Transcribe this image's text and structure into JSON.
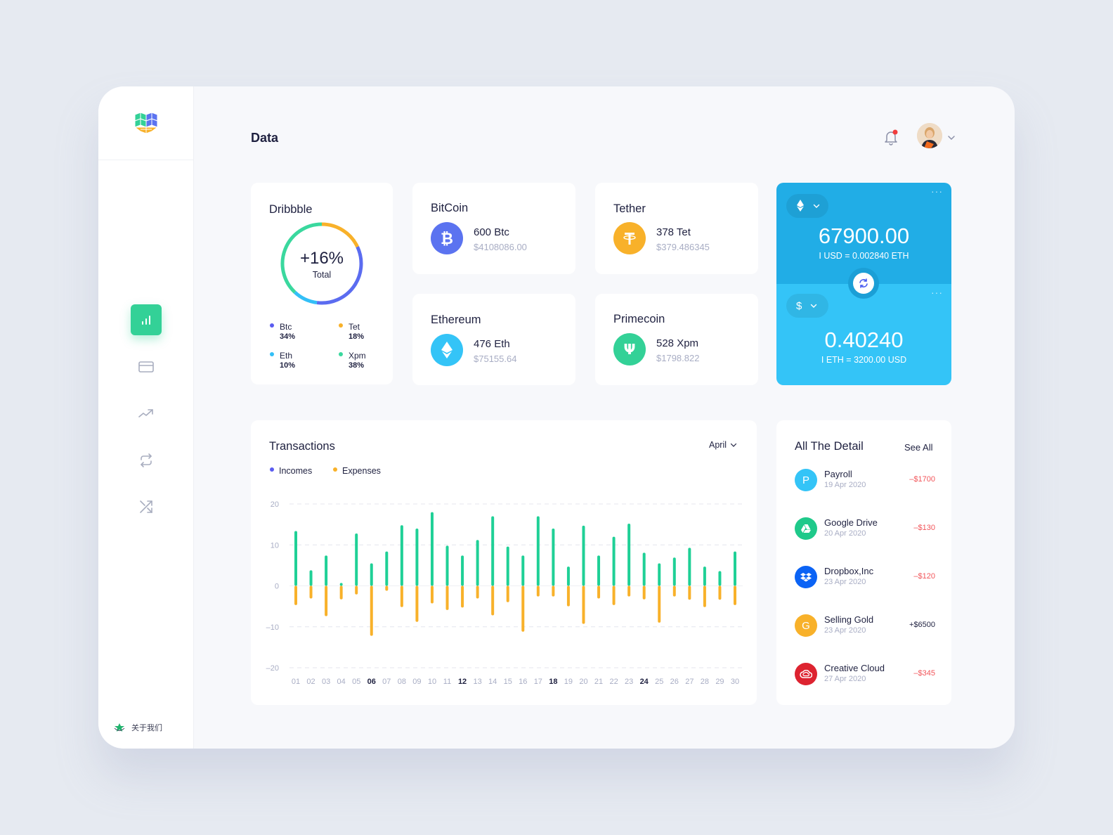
{
  "header": {
    "title": "Data",
    "notification_icon": "bell-icon",
    "has_unread_notification": true,
    "avatar": "user-avatar"
  },
  "sidebar": {
    "logo": "cube-logo",
    "items": [
      {
        "name": "dashboard",
        "icon": "bar-chart-icon",
        "active": true
      },
      {
        "name": "cards",
        "icon": "credit-card-icon",
        "active": false
      },
      {
        "name": "trends",
        "icon": "trending-up-icon",
        "active": false
      },
      {
        "name": "exchange",
        "icon": "repeat-icon",
        "active": false
      },
      {
        "name": "shuffle",
        "icon": "shuffle-icon",
        "active": false
      }
    ],
    "about_label": "关于我们"
  },
  "portfolio": {
    "title": "Dribbble",
    "total_value": "+16%",
    "total_label": "Total",
    "segments": [
      {
        "name": "Btc",
        "percent": 34,
        "percent_label": "34%",
        "color": "#5b6cf0"
      },
      {
        "name": "Tet",
        "percent": 18,
        "percent_label": "18%",
        "color": "#f8b12a"
      },
      {
        "name": "Eth",
        "percent": 10,
        "percent_label": "10%",
        "color": "#33bff7"
      },
      {
        "name": "Xpm",
        "percent": 38,
        "percent_label": "38%",
        "color": "#3ad89e"
      }
    ]
  },
  "coins": [
    {
      "title": "BitCoin",
      "amount": "600 Btc",
      "usd": "$4108086.00",
      "icon": "bitcoin-icon",
      "color": "#5b73f0"
    },
    {
      "title": "Tether",
      "amount": "378 Tet",
      "usd": "$379.486345",
      "icon": "tether-icon",
      "color": "#f8b12a"
    },
    {
      "title": "Ethereum",
      "amount": "476 Eth",
      "usd": "$75155.64",
      "icon": "ethereum-icon",
      "color": "#34c4f7"
    },
    {
      "title": "Primecoin",
      "amount": "528 Xpm",
      "usd": "$1798.822",
      "icon": "primecoin-icon",
      "color": "#33d197"
    }
  ],
  "exchange": {
    "from": {
      "currency_icon": "ethereum-icon",
      "value": "67900.00",
      "rate": "I USD = 0.002840 ETH"
    },
    "to": {
      "currency_symbol": "$",
      "value": "0.40240",
      "rate": "I ETH = 3200.00 USD"
    },
    "more_label": "···"
  },
  "transactions": {
    "title": "Transactions",
    "month": "April",
    "legend": [
      {
        "label": "Incomes",
        "color": "#5b5cf0"
      },
      {
        "label": "Expenses",
        "color": "#f8b12a"
      }
    ]
  },
  "chart_data": {
    "type": "bar",
    "title": "Transactions",
    "xlabel": "",
    "ylabel": "",
    "ylim": [
      -20,
      20
    ],
    "yticks": [
      "20",
      "10",
      "0",
      "–10",
      "–20"
    ],
    "ytick_values": [
      20,
      10,
      0,
      -10,
      -20
    ],
    "grid": true,
    "legend_position": "top-left",
    "categories": [
      "01",
      "02",
      "03",
      "04",
      "05",
      "06",
      "07",
      "08",
      "09",
      "10",
      "11",
      "12",
      "13",
      "14",
      "15",
      "16",
      "17",
      "18",
      "19",
      "20",
      "21",
      "22",
      "23",
      "24",
      "25",
      "26",
      "27",
      "28",
      "29",
      "30"
    ],
    "highlighted_categories": [
      "06",
      "12",
      "18",
      "24"
    ],
    "series": [
      {
        "name": "Incomes",
        "color": "#1fd096",
        "values": [
          13.4,
          3.8,
          7.4,
          0.7,
          12.8,
          5.5,
          8.4,
          14.8,
          14.0,
          18.0,
          9.8,
          7.4,
          11.2,
          17.0,
          9.6,
          7.4,
          17.0,
          14.0,
          4.7,
          14.7,
          7.4,
          12.0,
          15.2,
          8.1,
          5.5,
          6.9,
          9.3,
          4.7,
          3.6,
          8.4
        ]
      },
      {
        "name": "Expenses",
        "color": "#f8b12a",
        "values": [
          -4.7,
          -3.1,
          -7.4,
          -3.3,
          -2.1,
          -12.2,
          -1.2,
          -5.2,
          -8.8,
          -4.3,
          -5.9,
          -5.3,
          -3.1,
          -7.2,
          -4.0,
          -11.2,
          -2.6,
          -2.6,
          -5.0,
          -9.3,
          -3.1,
          -4.7,
          -2.6,
          -3.3,
          -9.0,
          -2.6,
          -3.4,
          -5.2,
          -3.4,
          -4.7
        ]
      }
    ]
  },
  "details": {
    "title": "All The Detail",
    "see_all_label": "See All",
    "items": [
      {
        "name": "Payroll",
        "date": "19 Apr 2020",
        "amount": "–$1700",
        "type": "expense",
        "icon": "letter-p-icon",
        "icon_text": "P",
        "color": "#34c4f7"
      },
      {
        "name": "Google Drive",
        "date": "20 Apr 2020",
        "amount": "–$130",
        "type": "expense",
        "icon": "google-drive-icon",
        "icon_text": "",
        "color": "#1fc98a"
      },
      {
        "name": "Dropbox,Inc",
        "date": "23 Apr 2020",
        "amount": "–$120",
        "type": "expense",
        "icon": "dropbox-icon",
        "icon_text": "",
        "color": "#0b63f5"
      },
      {
        "name": "Selling Gold",
        "date": "23 Apr 2020",
        "amount": "+$6500",
        "type": "income",
        "icon": "letter-g-icon",
        "icon_text": "G",
        "color": "#f8b12a"
      },
      {
        "name": "Creative Cloud",
        "date": "27 Apr 2020",
        "amount": "–$345",
        "type": "expense",
        "icon": "creative-cloud-icon",
        "icon_text": "",
        "color": "#dd2330"
      }
    ],
    "colors": {
      "expense": "#f2555a",
      "income": "#1f2140"
    }
  }
}
